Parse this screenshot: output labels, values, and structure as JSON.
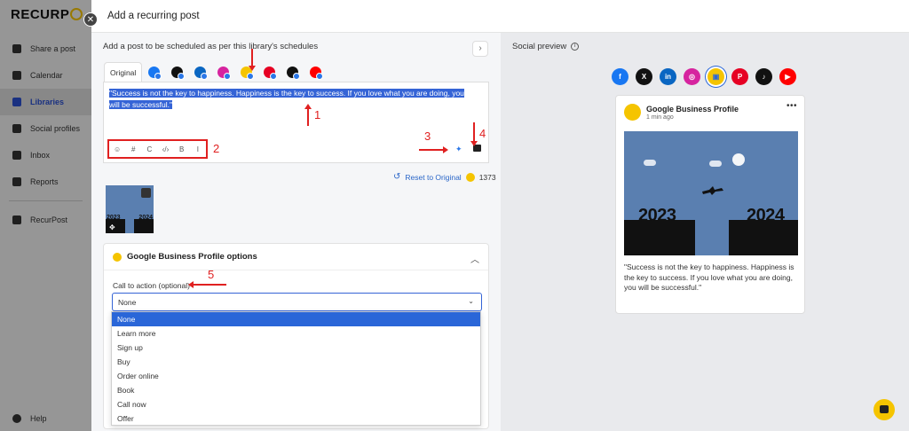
{
  "app": {
    "logo": "RECURP"
  },
  "sidebar": {
    "items": [
      {
        "label": "Share a post",
        "icon": "send-icon"
      },
      {
        "label": "Calendar",
        "icon": "calendar-icon"
      },
      {
        "label": "Libraries",
        "icon": "library-icon",
        "active": true
      },
      {
        "label": "Social profiles",
        "icon": "profile-icon"
      },
      {
        "label": "Inbox",
        "icon": "inbox-icon"
      },
      {
        "label": "Reports",
        "icon": "reports-icon"
      },
      {
        "label": "RecurPost",
        "icon": "monitor-icon"
      }
    ],
    "help_label": "Help"
  },
  "modal": {
    "title": "Add a recurring post",
    "description": "Add a post to be scheduled as per this library's schedules",
    "original_tab": "Original",
    "post_text": "\"Success is not the key to happiness. Happiness is the key to success. If you love what you are doing, you will be successful.\"",
    "format_buttons": [
      "☺",
      "#",
      "C",
      "‹/›",
      "B",
      "I"
    ],
    "reset_label": "Reset to Original",
    "char_count": "1373",
    "gbp_options_title": "Google Business Profile options",
    "cta_label": "Call to action (optional)",
    "cta_selected": "None",
    "cta_options": [
      "None",
      "Learn more",
      "Sign up",
      "Buy",
      "Order online",
      "Book",
      "Call now",
      "Offer"
    ]
  },
  "annotations": [
    "1",
    "2",
    "3",
    "4",
    "5"
  ],
  "preview": {
    "title": "Social preview",
    "networks": [
      {
        "name": "facebook",
        "glyph": "f",
        "color": "#1877f2"
      },
      {
        "name": "x",
        "glyph": "X",
        "color": "#111111"
      },
      {
        "name": "linkedin",
        "glyph": "in",
        "color": "#0a66c2"
      },
      {
        "name": "instagram",
        "glyph": "◎",
        "color": "#d6249f"
      },
      {
        "name": "google-business",
        "glyph": "▣",
        "color": "#f5c400",
        "selected": true
      },
      {
        "name": "pinterest",
        "glyph": "P",
        "color": "#e60023"
      },
      {
        "name": "tiktok",
        "glyph": "♪",
        "color": "#111111"
      },
      {
        "name": "youtube",
        "glyph": "▶",
        "color": "#ff0000"
      }
    ],
    "card": {
      "profile_name": "Google Business Profile",
      "time": "1 min ago",
      "year_left": "2023",
      "year_right": "2024",
      "text": "\"Success is not the key to happiness. Happiness is the key to success. If you love what you are doing, you will be successful.\""
    }
  },
  "colors": {
    "accent": "#2a66d8",
    "brand_yellow": "#f5c400",
    "annotation_red": "#e02020"
  }
}
